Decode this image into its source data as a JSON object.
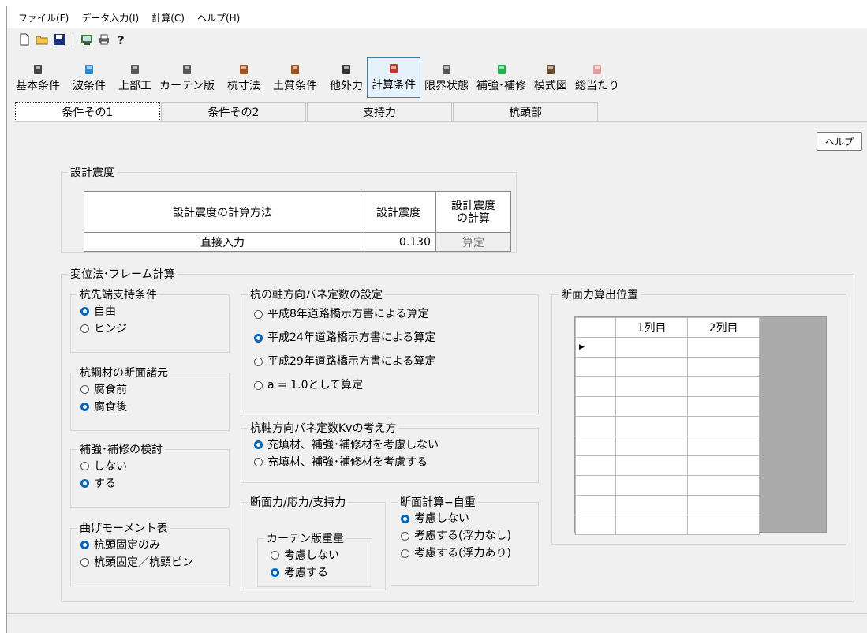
{
  "menu": {
    "file": "ファイル(F)",
    "data": "データ入力(I)",
    "calc": "計算(C)",
    "help": "ヘルプ(H)"
  },
  "toolbar": [
    {
      "label": "基本条件",
      "icon": "calculator-icon"
    },
    {
      "label": "波条件",
      "icon": "wave-icon"
    },
    {
      "label": "上部工",
      "icon": "structure-icon"
    },
    {
      "label": "カーテン版",
      "icon": "curtain-icon"
    },
    {
      "label": "杭寸法",
      "icon": "pile-icon"
    },
    {
      "label": "土質条件",
      "icon": "soil-icon"
    },
    {
      "label": "他外力",
      "icon": "force-icon"
    },
    {
      "label": "計算条件",
      "icon": "calc-icon"
    },
    {
      "label": "限界状態",
      "icon": "limit-icon"
    },
    {
      "label": "補強･補修",
      "icon": "plus-icon"
    },
    {
      "label": "模式図",
      "icon": "diagram-icon"
    },
    {
      "label": "総当たり",
      "icon": "round-robin-icon"
    }
  ],
  "tabs": [
    "条件その1",
    "条件その2",
    "支持力",
    "杭頭部"
  ],
  "help_button": "ヘルプ",
  "seismic": {
    "legend": "設計震度",
    "col_method": "設計震度の計算方法",
    "col_value": "設計震度",
    "col_calc": "設計震度の計算",
    "method": "直接入力",
    "value": "0.130",
    "calc_button": "算定"
  },
  "frame": {
    "legend": "変位法･フレーム計算",
    "tip": {
      "legend": "杭先端支持条件",
      "options": [
        "自由",
        "ヒンジ"
      ],
      "selected": 0
    },
    "steel": {
      "legend": "杭鋼材の断面諸元",
      "options": [
        "腐食前",
        "腐食後"
      ],
      "selected": 1
    },
    "reinforce": {
      "legend": "補強･補修の検討",
      "options": [
        "しない",
        "する"
      ],
      "selected": 1
    },
    "moment": {
      "legend": "曲げモーメント表",
      "options": [
        "杭頭固定のみ",
        "杭頭固定／杭頭ピン"
      ],
      "selected": 0
    },
    "spring": {
      "legend": "杭の軸方向バネ定数の設定",
      "options": [
        "平成8年道路橋示方書による算定",
        "平成24年道路橋示方書による算定",
        "平成29年道路橋示方書による算定",
        "a = 1.0として算定"
      ],
      "selected": 1
    },
    "kv": {
      "legend": "杭軸方向バネ定数Kvの考え方",
      "options": [
        "充填材、補強･補修材を考慮しない",
        "充填材、補強･補修材を考慮する"
      ],
      "selected": 0
    },
    "section_force": {
      "legend": "断面力/応力/支持力",
      "curtain": {
        "legend": "カーテン版重量",
        "options": [
          "考慮しない",
          "考慮する"
        ],
        "selected": 1
      }
    },
    "self_weight": {
      "legend": "断面計算−自重",
      "options": [
        "考慮しない",
        "考慮する(浮力なし)",
        "考慮する(浮力あり)"
      ],
      "selected": 0
    },
    "position": {
      "legend": "断面力算出位置",
      "headers": [
        "1列目",
        "2列目"
      ],
      "row_marker": "▶"
    }
  }
}
